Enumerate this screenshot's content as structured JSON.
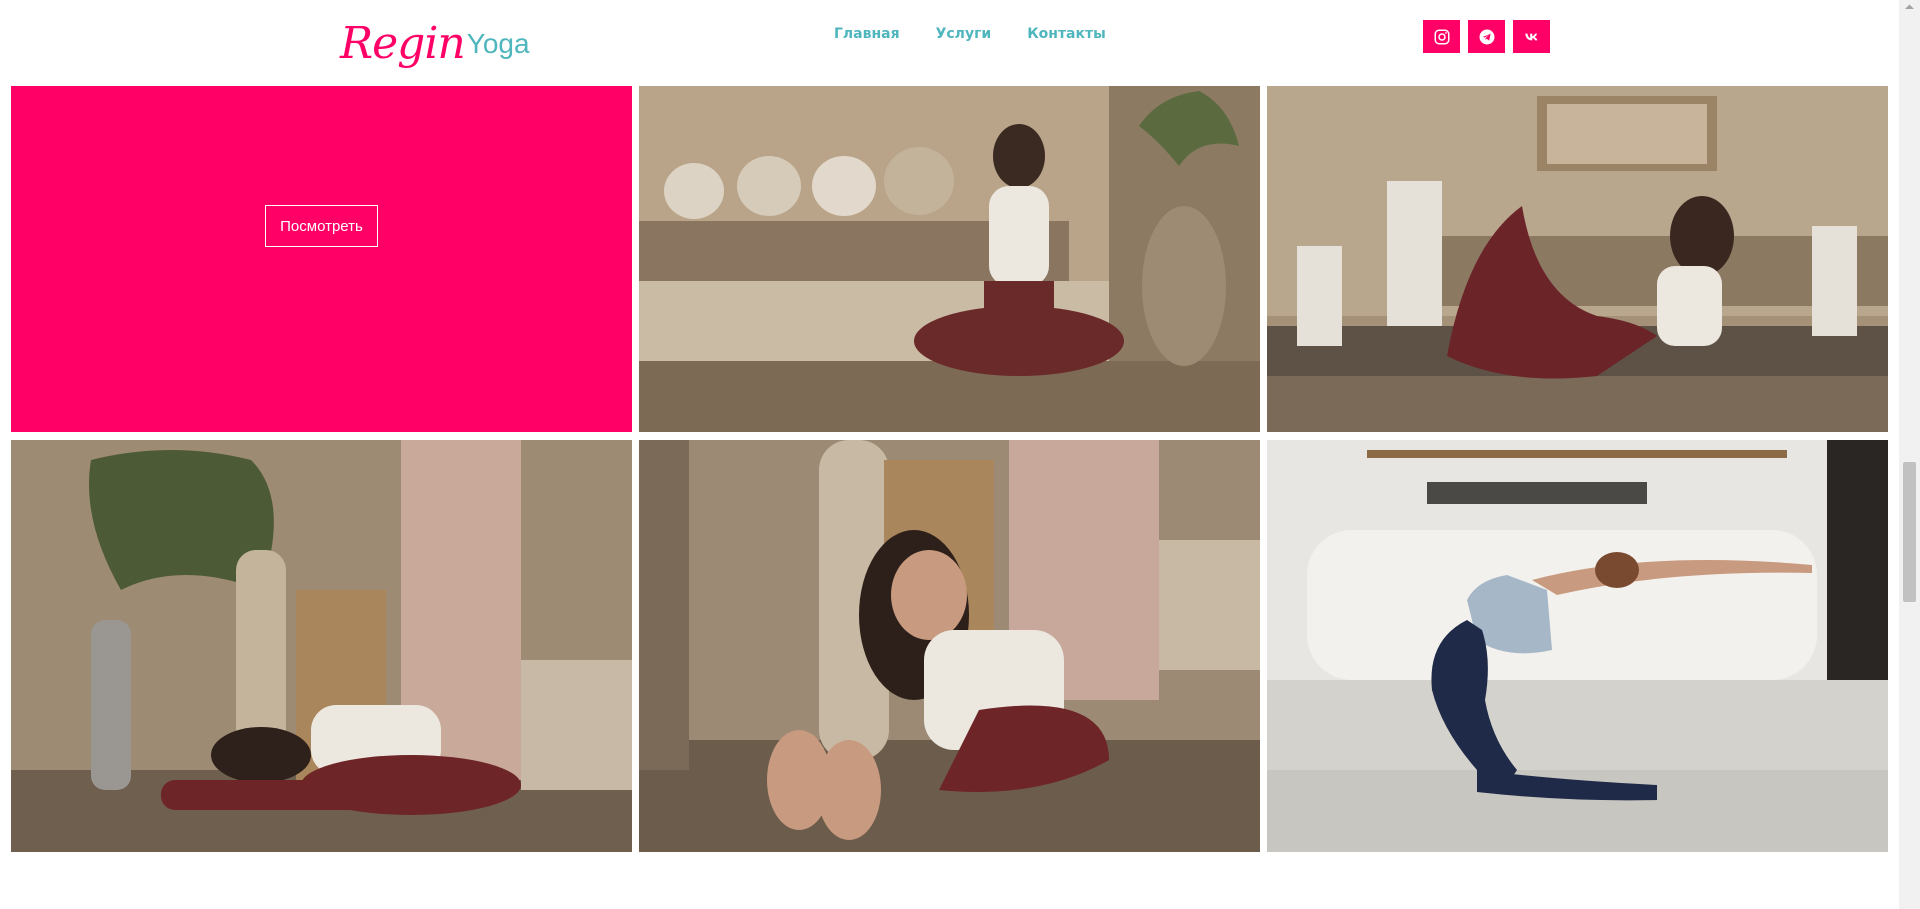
{
  "header": {
    "logo": {
      "part1": "Regin",
      "part2": "Yoga"
    },
    "nav": [
      {
        "label": "Главная"
      },
      {
        "label": "Услуги"
      },
      {
        "label": "Контакты"
      }
    ],
    "social": [
      {
        "icon": "instagram-icon"
      },
      {
        "icon": "telegram-icon"
      },
      {
        "icon": "vk-icon"
      }
    ]
  },
  "gallery": {
    "promo": {
      "button_label": "Посмотреть",
      "background": "#ff0066"
    },
    "photos": [
      {
        "subject": "seated meditation"
      },
      {
        "subject": "bow pose"
      },
      {
        "subject": "forward fold"
      },
      {
        "subject": "smiling stretch"
      },
      {
        "subject": "camel pose"
      }
    ]
  },
  "colors": {
    "accent": "#ff0066",
    "nav_text": "#4fb6bd"
  }
}
